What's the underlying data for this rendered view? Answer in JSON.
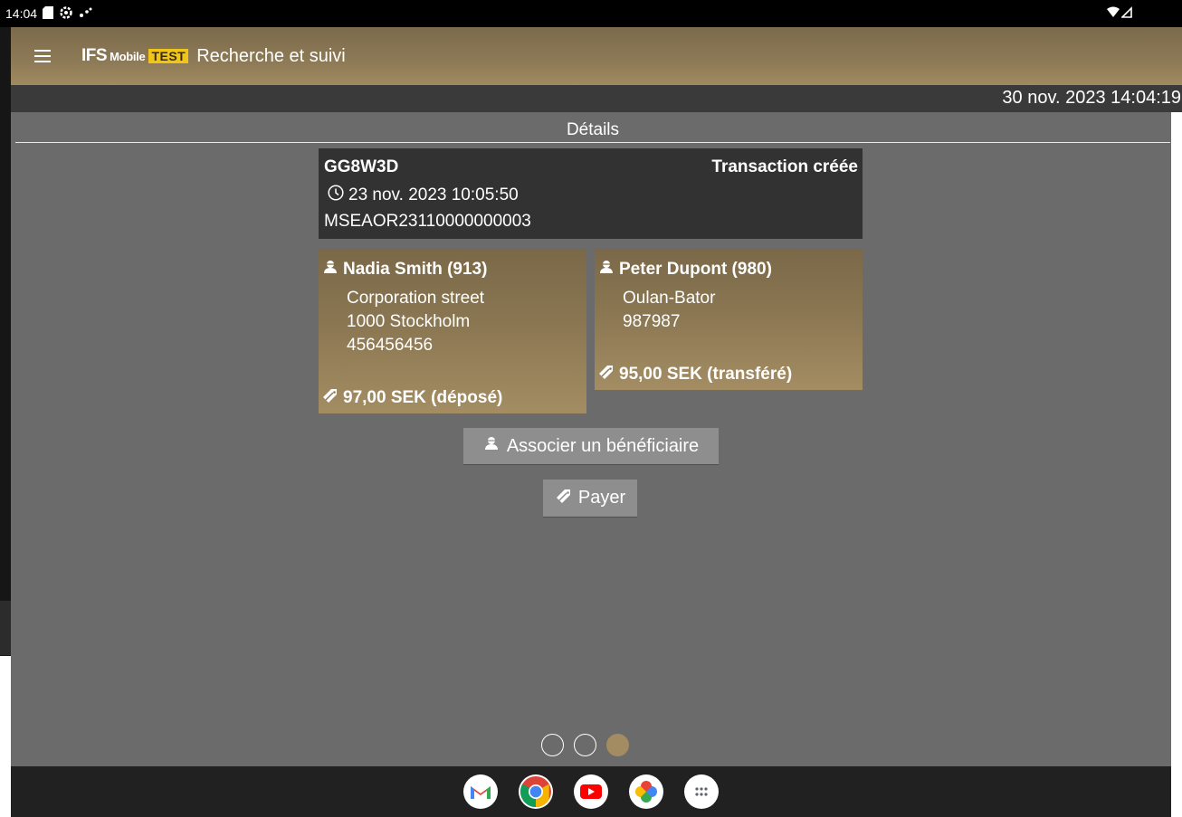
{
  "status_bar": {
    "time": "14:04"
  },
  "app_bar": {
    "logo_ifs": "IFS",
    "logo_mobile": "Mobile",
    "logo_test": "TEST",
    "title": "Recherche et suivi"
  },
  "date_bar": {
    "datetime": "30 nov. 2023 14:04:19"
  },
  "details": {
    "header": "Détails",
    "transaction": {
      "code": "GG8W3D",
      "status": "Transaction créée",
      "date": "23 nov. 2023 10:05:50",
      "reference": "MSEAOR23110000000003"
    },
    "sender": {
      "name": "Nadia Smith (913)",
      "lines": [
        "Corporation street",
        "1000 Stockholm",
        "456456456"
      ],
      "amount": "97,00 SEK (déposé)"
    },
    "receiver": {
      "name": "Peter Dupont (980)",
      "lines": [
        "Oulan-Bator",
        "987987"
      ],
      "amount": "95,00 SEK (transféré)"
    }
  },
  "actions": {
    "associate_label": "Associer un bénéficiaire",
    "pay_label": "Payer"
  },
  "pager": {
    "pages": 3,
    "current": 3
  },
  "taskbar": {
    "apps": [
      "gmail-icon",
      "chrome-icon",
      "youtube-icon",
      "photos-icon",
      "app-drawer-icon"
    ]
  },
  "colors": {
    "accent": "#a38b62",
    "app_bar": "#8d7a56",
    "test_badge": "#f0c419",
    "card_dark": "#323232",
    "background": "#6b6b6b"
  }
}
